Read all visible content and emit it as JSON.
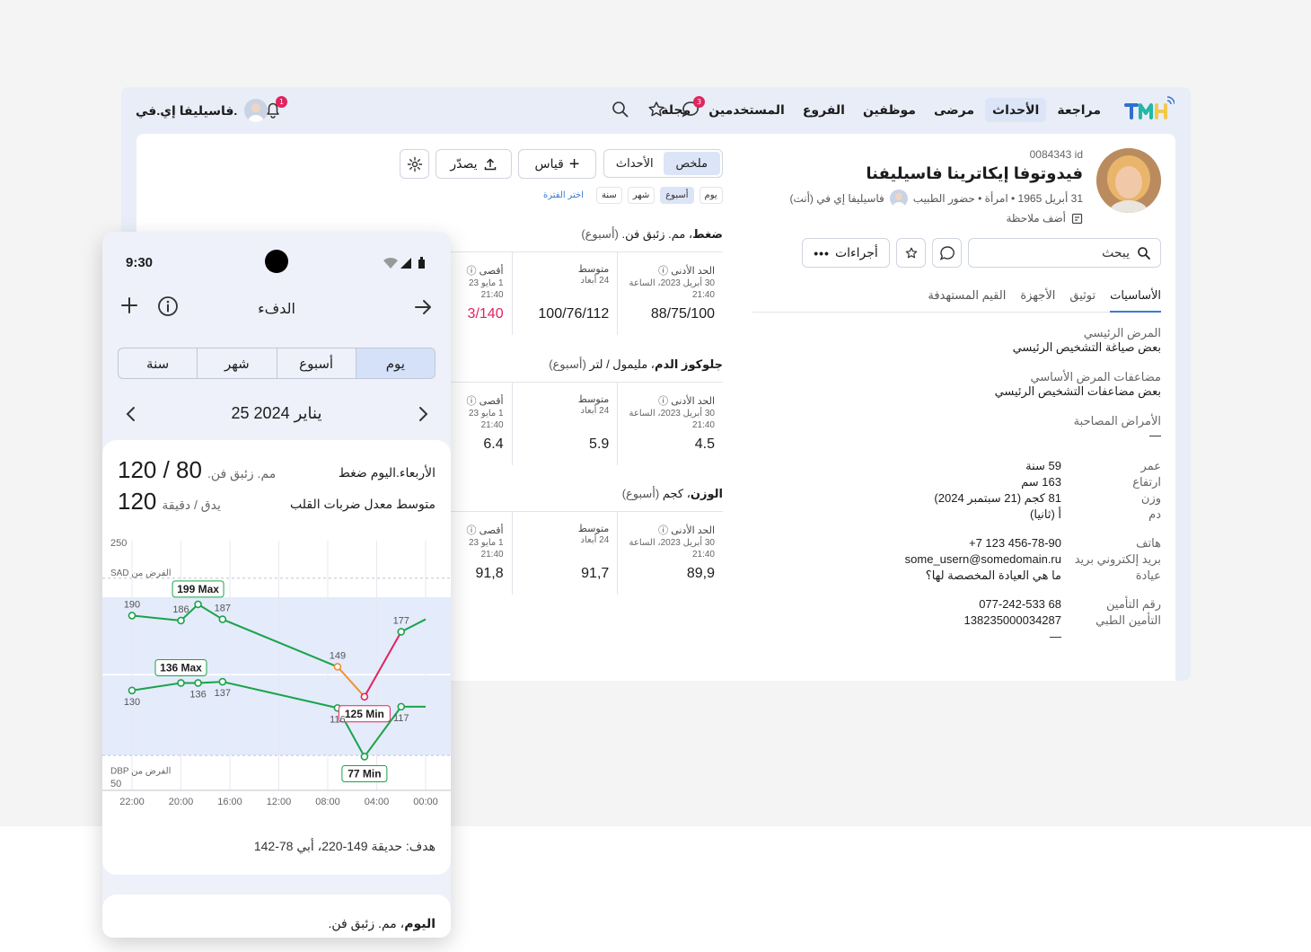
{
  "nav": {
    "items": [
      "مراجعة",
      "الأحداث",
      "مرضى",
      "موظفين",
      "الفروع",
      "المستخدمين",
      "مجلة"
    ],
    "active_index": 1,
    "chat_badge": "3",
    "bell_badge": "1",
    "user_name": "فاسيليفا إي.في."
  },
  "patient": {
    "id": "0084343 id",
    "name": "فيدوتوفا إيكاترينا فاسيليفنا",
    "meta": "31 أبريل 1965 • امرأة • حضور الطبيب",
    "doctor": "فاسيليفا إي في (أنت)",
    "add_note": "أضف ملاحظة",
    "search_placeholder": "يبحث",
    "actions_label": "أجراءات",
    "tabs": [
      "الأساسيات",
      "توثيق",
      "الأجهزة",
      "القيم المستهدفة"
    ],
    "main_disease_label": "المرض الرئيسي",
    "main_disease_value": "بعض صياغة التشخيص الرئيسي",
    "complications_label": "مضاعفات المرض الأساسي",
    "complications_value": "بعض مضاعفات التشخيص الرئيسي",
    "comorbid_label": "الأمراض المصاحبة",
    "comorbid_value": "—",
    "age_label": "عمر",
    "age_value": "59 سنة",
    "height_label": "ارتفاع",
    "height_value": "163 سم",
    "weight_label": "وزن",
    "weight_value": "81 كجم (21 سبتمبر 2024)",
    "blood_label": "دم",
    "blood_value": "أ (ثانيا)",
    "phone_label": "هاتف",
    "phone_value": "+7 123 456-78-90",
    "email_label": "بريد إلكتروني بريد",
    "email_value": "some_usern@somedomain.ru",
    "clinic_label": "عيادة",
    "clinic_value": "ما هي العيادة المخصصة لها؟",
    "insurance_label": "رقم التأمين",
    "insurance_value": "077-242-533 68",
    "medical_label": "التأمين الطبي",
    "medical_value": "138235000034287",
    "medical_extra": "—"
  },
  "metrics_panel": {
    "segment": [
      "ملخص",
      "الأحداث"
    ],
    "measure_label": "قياس",
    "export_label": "يصدّر",
    "periods": [
      "يوم",
      "أسبوع",
      "شهر",
      "سنة"
    ],
    "period_active": 1,
    "period_link": "اختر الفترة",
    "metrics": [
      {
        "title_bold": "ضغط",
        "title_rest": "، مم. زئبق فن.",
        "period": "(أسبوع)",
        "min_label": "الحد الأدنى",
        "min_sub1": "30 أبريل 2023، الساعة",
        "min_sub2": "21:40",
        "min_value": "88/75/100",
        "avg_label": "متوسط",
        "avg_sub": "24 أبعاد",
        "avg_value": "100/76/112",
        "max_label": "أقصى",
        "max_sub1": "1 مايو 23",
        "max_sub2": "21:40",
        "max_value": "3/140"
      },
      {
        "title_bold": "جلوكوز الدم",
        "title_rest": "، مليمول / لتر",
        "period": "(أسبوع)",
        "min_label": "الحد الأدنى",
        "min_sub1": "30 أبريل 2023، الساعة",
        "min_sub2": "21:40",
        "min_value": "4.5",
        "avg_label": "متوسط",
        "avg_sub": "24 أبعاد",
        "avg_value": "5.9",
        "max_label": "أقصى",
        "max_sub1": "1 مايو 23",
        "max_sub2": "21:40",
        "max_value": "6.4"
      },
      {
        "title_bold": "الوزن",
        "title_rest": "، كجم",
        "period": "(أسبوع)",
        "min_label": "الحد الأدنى",
        "min_sub1": "30 أبريل 2023، الساعة",
        "min_sub2": "21:40",
        "min_value": "89,9",
        "avg_label": "متوسط",
        "avg_sub": "24 أبعاد",
        "avg_value": "91,7",
        "max_label": "أقصى",
        "max_sub1": "1 مايو 23",
        "max_sub2": "21:40",
        "max_value": "91,8"
      }
    ]
  },
  "phone": {
    "time": "9:30",
    "title": "الدفء",
    "segments": [
      "يوم",
      "أسبوع",
      "شهر",
      "سنة"
    ],
    "segment_active": 0,
    "date": "25 يناير 2024",
    "bp_label": "الأربعاء.اليوم ضغط",
    "bp_value": "120 / 80",
    "bp_unit": "مم. زئبق فن.",
    "hr_label": "متوسط معدل ضربات القلب",
    "hr_value": "120",
    "hr_unit": "يدق / دقيقة",
    "sad_label": "SAD الفرض من",
    "dbp_label": "DBP الفرض من",
    "goal": "هدف: حديقة 149-220، أبي 78-142",
    "today_label": "اليوم",
    "today_unit": "، مم. زئبق فن."
  },
  "chart_data": {
    "type": "line",
    "x": [
      "22:00",
      "20:00",
      "16:00",
      "12:00",
      "08:00",
      "04:00",
      "00:00"
    ],
    "ylim": [
      50,
      250
    ],
    "y_ticks": [
      50,
      250
    ],
    "series": [
      {
        "points": [
          [
            0,
            190
          ],
          [
            1,
            186
          ],
          [
            1.35,
            199
          ],
          [
            1.85,
            187
          ],
          [
            4.2,
            149
          ],
          [
            4.75,
            125
          ],
          [
            5.5,
            177
          ],
          [
            6,
            187
          ]
        ]
      },
      {
        "points": [
          [
            0,
            130
          ],
          [
            1,
            136
          ],
          [
            1.35,
            136
          ],
          [
            1.85,
            137
          ],
          [
            4.2,
            116
          ],
          [
            4.75,
            77
          ],
          [
            5.5,
            117
          ],
          [
            6,
            117
          ]
        ]
      }
    ],
    "point_labels": [
      {
        "series": 0,
        "index": 0,
        "text": "190"
      },
      {
        "series": 0,
        "index": 1,
        "text": "186"
      },
      {
        "series": 0,
        "index": 2,
        "text": "199 Max",
        "tag": true
      },
      {
        "series": 0,
        "index": 3,
        "text": "187"
      },
      {
        "series": 0,
        "index": 4,
        "text": "149"
      },
      {
        "series": 0,
        "index": 5,
        "text": "125 Min",
        "tag": true
      },
      {
        "series": 0,
        "index": 6,
        "text": "177"
      },
      {
        "series": 1,
        "index": 0,
        "text": "130"
      },
      {
        "series": 1,
        "index": 1,
        "text": "136 Max",
        "tag": true
      },
      {
        "series": 1,
        "index": 2,
        "text": "136"
      },
      {
        "series": 1,
        "index": 3,
        "text": "137"
      },
      {
        "series": 1,
        "index": 4,
        "text": "116"
      },
      {
        "series": 1,
        "index": 5,
        "text": "77 Min",
        "tag": true
      },
      {
        "series": 1,
        "index": 6,
        "text": "117"
      }
    ],
    "colors": {
      "line": "#1aa34a",
      "warn": "#f0902c",
      "alert": "#e0245e",
      "band": "#e4ebfb"
    }
  }
}
